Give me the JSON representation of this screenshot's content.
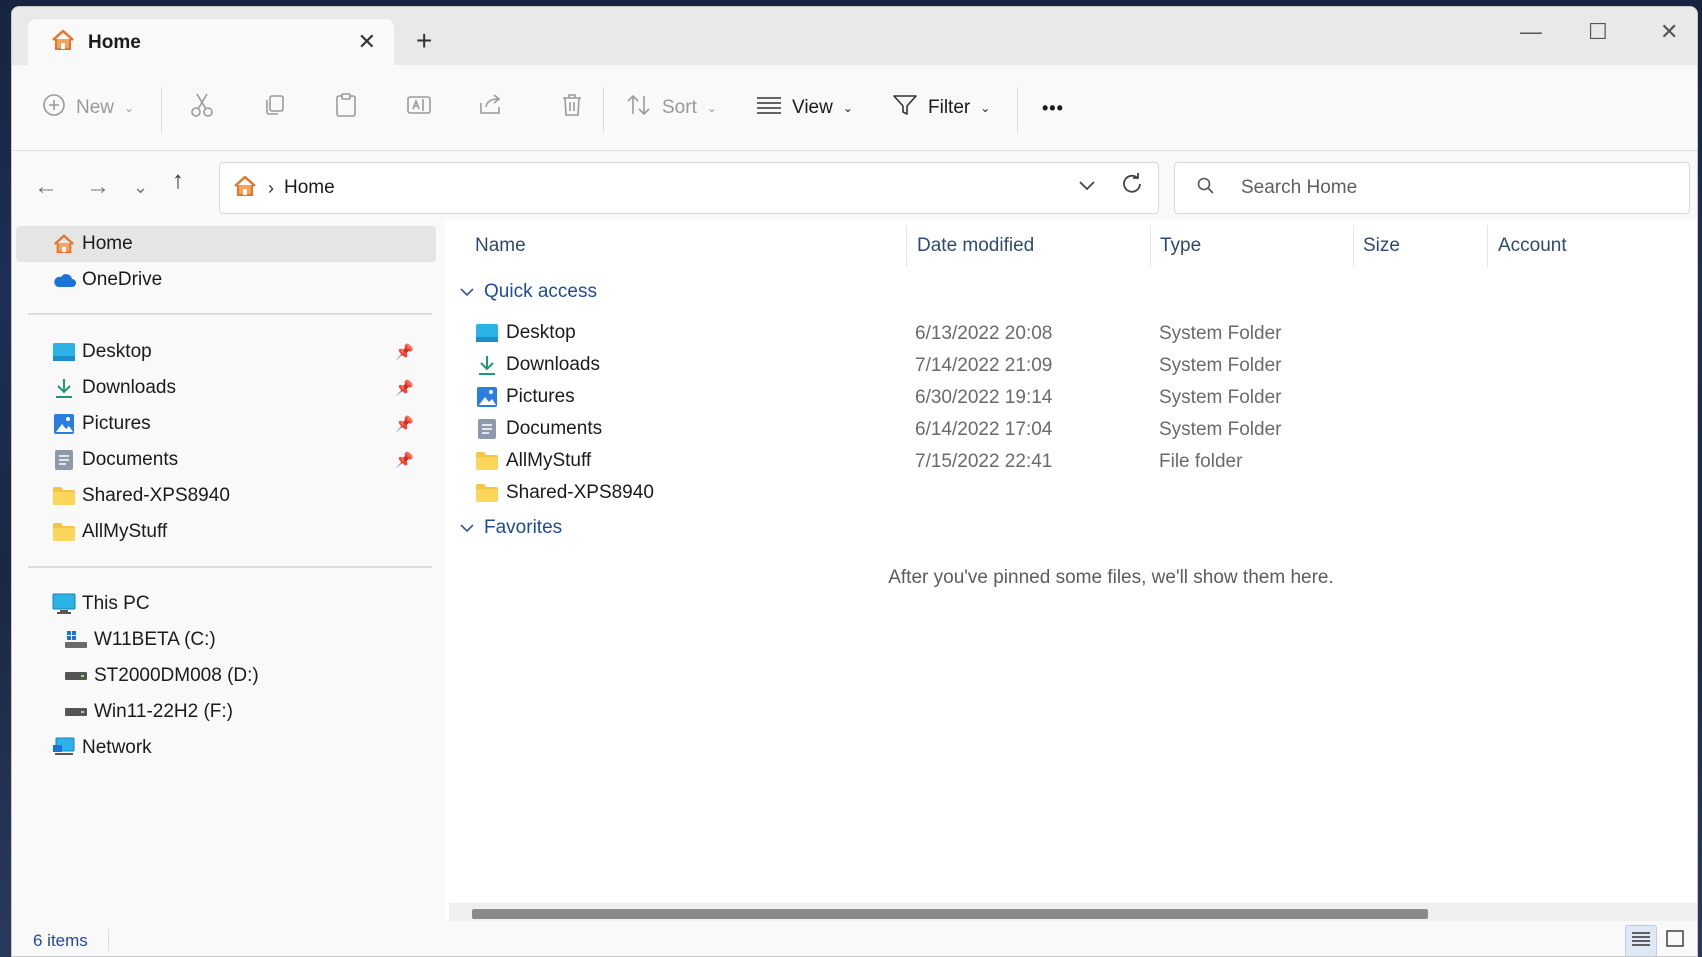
{
  "tab": {
    "title": "Home",
    "close_icon": "close-icon",
    "new_tab": "+"
  },
  "window_controls": {
    "minimize": "—",
    "maximize": "☐",
    "close": "✕"
  },
  "toolbar": {
    "new_label": "New",
    "sort_label": "Sort",
    "view_label": "View",
    "filter_label": "Filter",
    "more_label": "•••"
  },
  "address": {
    "crumb": "Home",
    "separator": "›"
  },
  "search": {
    "placeholder": "Search Home"
  },
  "sidebar": {
    "top": [
      {
        "label": "Home",
        "icon": "home-icon"
      },
      {
        "label": "OneDrive",
        "icon": "onedrive-icon"
      }
    ],
    "quick": [
      {
        "label": "Desktop",
        "icon": "desktop-folder-icon",
        "pinned": true
      },
      {
        "label": "Downloads",
        "icon": "downloads-icon",
        "pinned": true
      },
      {
        "label": "Pictures",
        "icon": "pictures-icon",
        "pinned": true
      },
      {
        "label": "Documents",
        "icon": "documents-icon",
        "pinned": true
      },
      {
        "label": "Shared-XPS8940",
        "icon": "folder-icon",
        "pinned": false
      },
      {
        "label": "AllMyStuff",
        "icon": "folder-icon",
        "pinned": false
      }
    ],
    "pc": [
      {
        "label": "This PC",
        "icon": "computer-icon"
      },
      {
        "label": "W11BETA (C:)",
        "icon": "windows-drive-icon"
      },
      {
        "label": "ST2000DM008 (D:)",
        "icon": "drive-icon"
      },
      {
        "label": "Win11-22H2  (F:)",
        "icon": "drive-icon"
      },
      {
        "label": "Network",
        "icon": "network-icon"
      }
    ]
  },
  "columns": {
    "name": "Name",
    "date": "Date modified",
    "type": "Type",
    "size": "Size",
    "account": "Account"
  },
  "groups": {
    "quick_access": "Quick access",
    "favorites": "Favorites",
    "favorites_empty": "After you've pinned some files, we'll show them here."
  },
  "files": [
    {
      "name": "Desktop",
      "date": "6/13/2022 20:08",
      "type": "System Folder",
      "icon": "desktop-folder-icon"
    },
    {
      "name": "Downloads",
      "date": "7/14/2022 21:09",
      "type": "System Folder",
      "icon": "downloads-icon"
    },
    {
      "name": "Pictures",
      "date": "6/30/2022 19:14",
      "type": "System Folder",
      "icon": "pictures-icon"
    },
    {
      "name": "Documents",
      "date": "6/14/2022 17:04",
      "type": "System Folder",
      "icon": "documents-icon"
    },
    {
      "name": "AllMyStuff",
      "date": "7/15/2022 22:41",
      "type": "File folder",
      "icon": "folder-icon"
    },
    {
      "name": "Shared-XPS8940",
      "date": "",
      "type": "",
      "icon": "folder-icon"
    }
  ],
  "status": {
    "count": "6 items"
  },
  "colors": {
    "accent": "#1f4a9c",
    "home_orange": "#e8732a",
    "folder_yellow": "#f6c342",
    "selected_bg": "#e5e5e5"
  }
}
